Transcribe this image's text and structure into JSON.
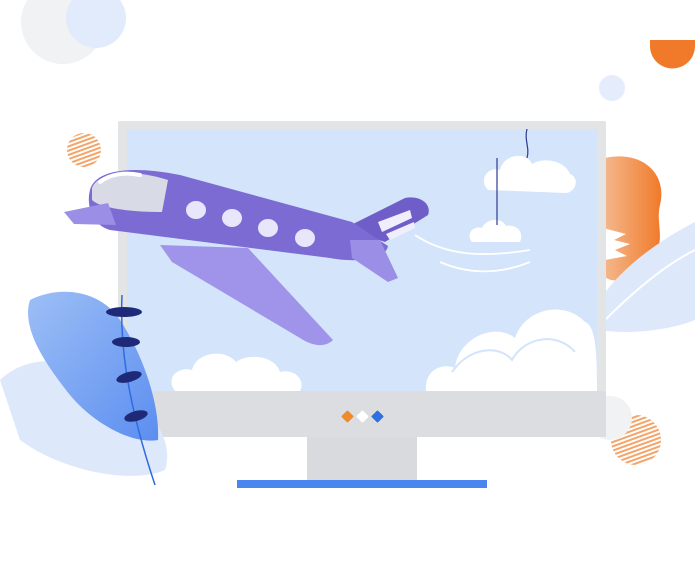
{
  "illustration": {
    "subject": "airplane-on-monitor",
    "icons": [
      "airplane-icon",
      "cloud-icon",
      "monitor-icon",
      "leaf-icon"
    ]
  },
  "colors": {
    "monitor_frame": "#e3e4e6",
    "monitor_chin": "#d9dadd",
    "screen": "#d3e4fb",
    "stand_base": "#4a86f0",
    "plane_body": "#7c6bd3",
    "plane_wing": "#9b8ee6",
    "plane_window": "#e8e6fb",
    "cockpit": "#d8dbe6",
    "cloud": "#ffffff",
    "orange": "#f07a2a",
    "leaf_blue": "#6d9cf2",
    "dark_navy": "#1e2a78"
  },
  "pagination": {
    "count": 3,
    "dots": [
      {
        "color": "#f08a2a"
      },
      {
        "color": "#ffffff"
      },
      {
        "color": "#2f6fe0"
      }
    ]
  }
}
